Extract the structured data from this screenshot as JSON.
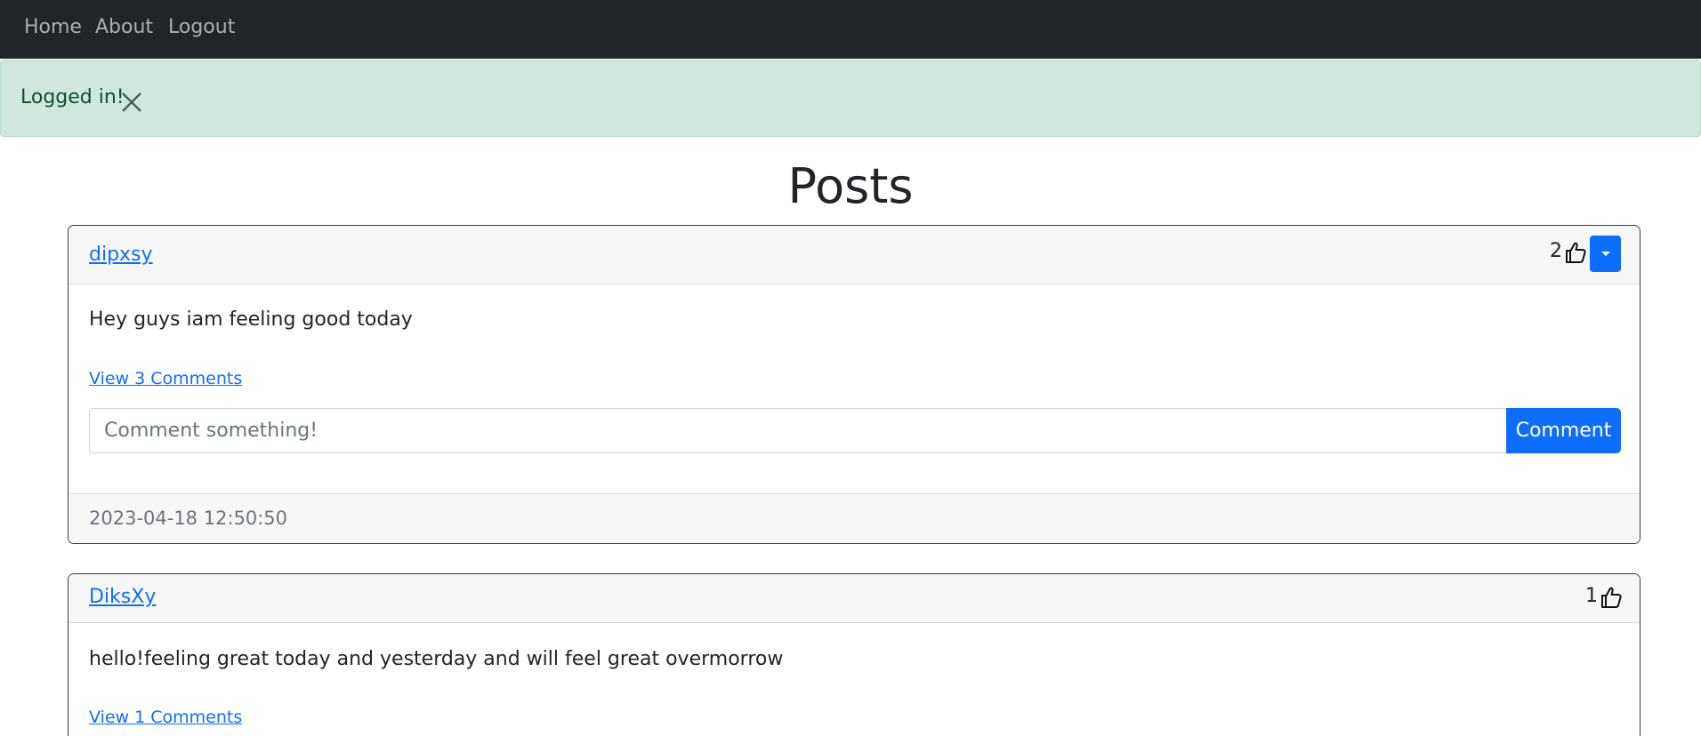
{
  "nav": {
    "links": [
      {
        "label": "Home"
      },
      {
        "label": "About"
      },
      {
        "label": "Logout"
      }
    ]
  },
  "alert": {
    "message": "Logged in!"
  },
  "page": {
    "title": "Posts"
  },
  "posts": [
    {
      "author": "dipxsy",
      "likes": "2",
      "text": "Hey guys iam feeling good today",
      "comments_link": "View 3 Comments",
      "comment_placeholder": "Comment something!",
      "comment_button": "Comment",
      "timestamp": "2023-04-18 12:50:50"
    },
    {
      "author": "DiksXy",
      "likes": "1",
      "text": "hello!feeling great today and yesterday and will feel great overmorrow",
      "comments_link": "View 1 Comments"
    }
  ]
}
